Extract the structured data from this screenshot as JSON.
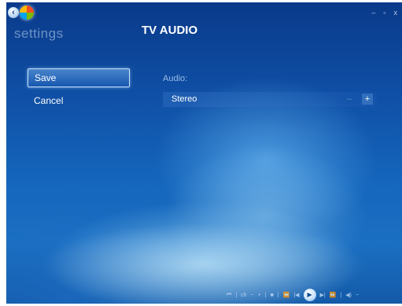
{
  "header": {
    "section_label": "settings",
    "title": "TV AUDIO",
    "icons": [
      "back-icon",
      "windows-orb-icon"
    ]
  },
  "window_controls": {
    "minimize": "–",
    "restore": "▫",
    "close": "x"
  },
  "menu": {
    "save_label": "Save",
    "cancel_label": "Cancel",
    "focused": "Save"
  },
  "audio": {
    "label": "Audio:",
    "value": "Stereo",
    "decrement": "–",
    "increment": "+"
  },
  "transport": {
    "items": [
      "⏮",
      "|",
      "ch",
      "−",
      "+",
      "|",
      "■",
      "|",
      "⏪",
      "|◀",
      "▶",
      "▶|",
      "⏩",
      "|",
      "◀)",
      "−"
    ]
  },
  "colors": {
    "background": "#1566bd",
    "title": "#ffffff",
    "subtle_text": "#afcdeb"
  }
}
